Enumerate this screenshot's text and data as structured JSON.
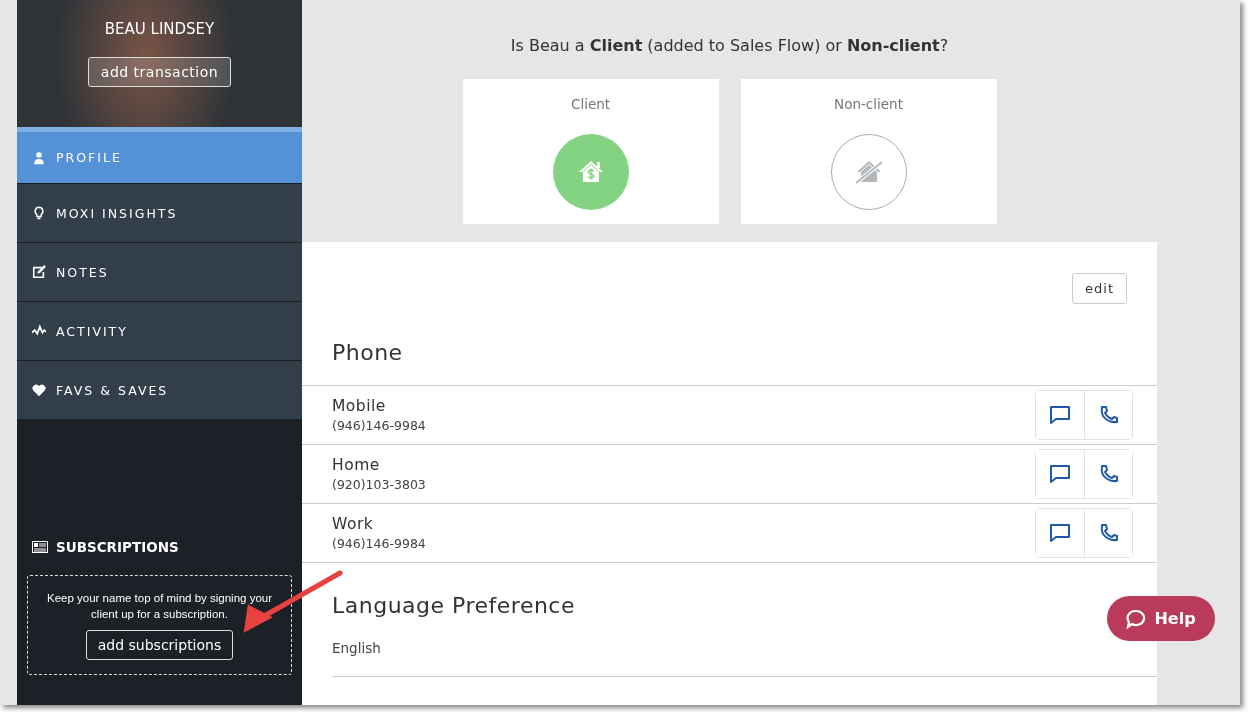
{
  "sidebar": {
    "contact_name": "BEAU LINDSEY",
    "add_transaction_button": "add transaction",
    "nav_items": [
      {
        "label": "PROFILE",
        "kind": "person",
        "selected": true
      },
      {
        "label": "MOXI INSIGHTS",
        "kind": "bulb",
        "selected": false
      },
      {
        "label": "NOTES",
        "kind": "edit",
        "selected": false
      },
      {
        "label": "ACTIVITY",
        "kind": "pulse",
        "selected": false
      },
      {
        "label": "FAVS & SAVES",
        "kind": "heart",
        "selected": false
      }
    ],
    "subscriptions": {
      "title": "SUBSCRIPTIONS",
      "text": "Keep your name top of mind by signing your client up for a subscription.",
      "button": "add subscriptions"
    }
  },
  "main": {
    "question": "Is Beau a **Client** (added to Sales Flow) or **Non-client**?",
    "choices": [
      {
        "label": "Client",
        "kind": "client",
        "selected": true
      },
      {
        "label": "Non-client",
        "kind": "non-client",
        "selected": false
      }
    ],
    "edit_button": "edit",
    "phone": {
      "heading": "Phone",
      "numbers": [
        {
          "label": "Mobile",
          "number": "(946)146-9984"
        },
        {
          "label": "Home",
          "number": "(920)103-3803"
        },
        {
          "label": "Work",
          "number": "(946)146-9984"
        }
      ]
    },
    "language": {
      "heading": "Language Preference",
      "value": "English"
    }
  },
  "help_button": "Help"
}
